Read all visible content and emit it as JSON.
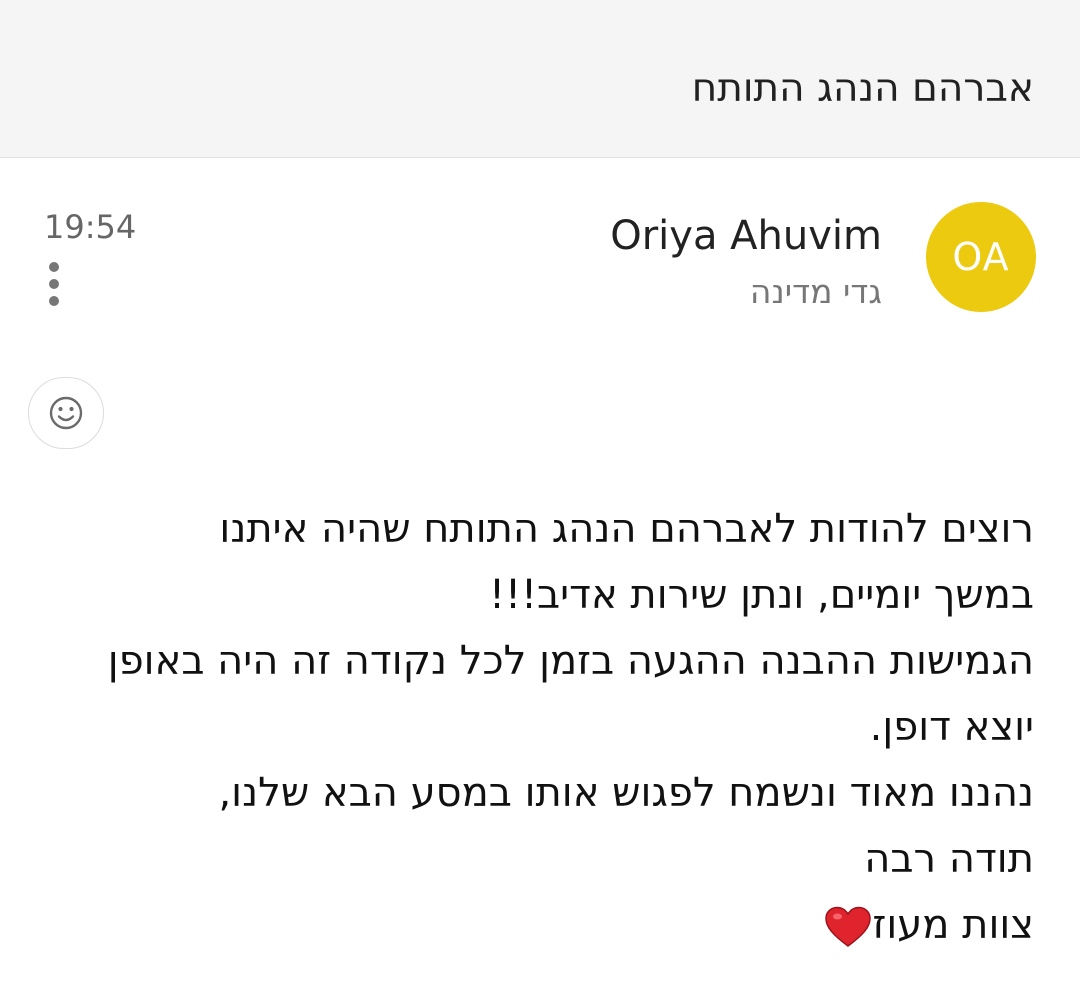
{
  "header": {
    "subject": "אברהם הנהג התותח"
  },
  "message": {
    "avatar_initials": "OA",
    "avatar_color": "#ecca10",
    "sender_name": "Oriya Ahuvim",
    "sender_subtitle": "גדי מדינה",
    "time": "19:54",
    "more_icon": "more-vertical-icon",
    "reaction_icon": "smiley-icon",
    "body_lines": [
      "רוצים להודות לאברהם הנהג התותח שהיה איתנו",
      "במשך יומיים, ונתן שירות אדיב!!!",
      "הגמישות ההבנה ההגעה בזמן לכל נקודה זה היה באופן",
      "יוצא דופן.",
      "נהננו מאוד ונשמח לפגוש אותו במסע הבא שלנו,",
      "תודה רבה",
      "צוות מעוז"
    ],
    "signature_icon": "red-heart-icon"
  }
}
